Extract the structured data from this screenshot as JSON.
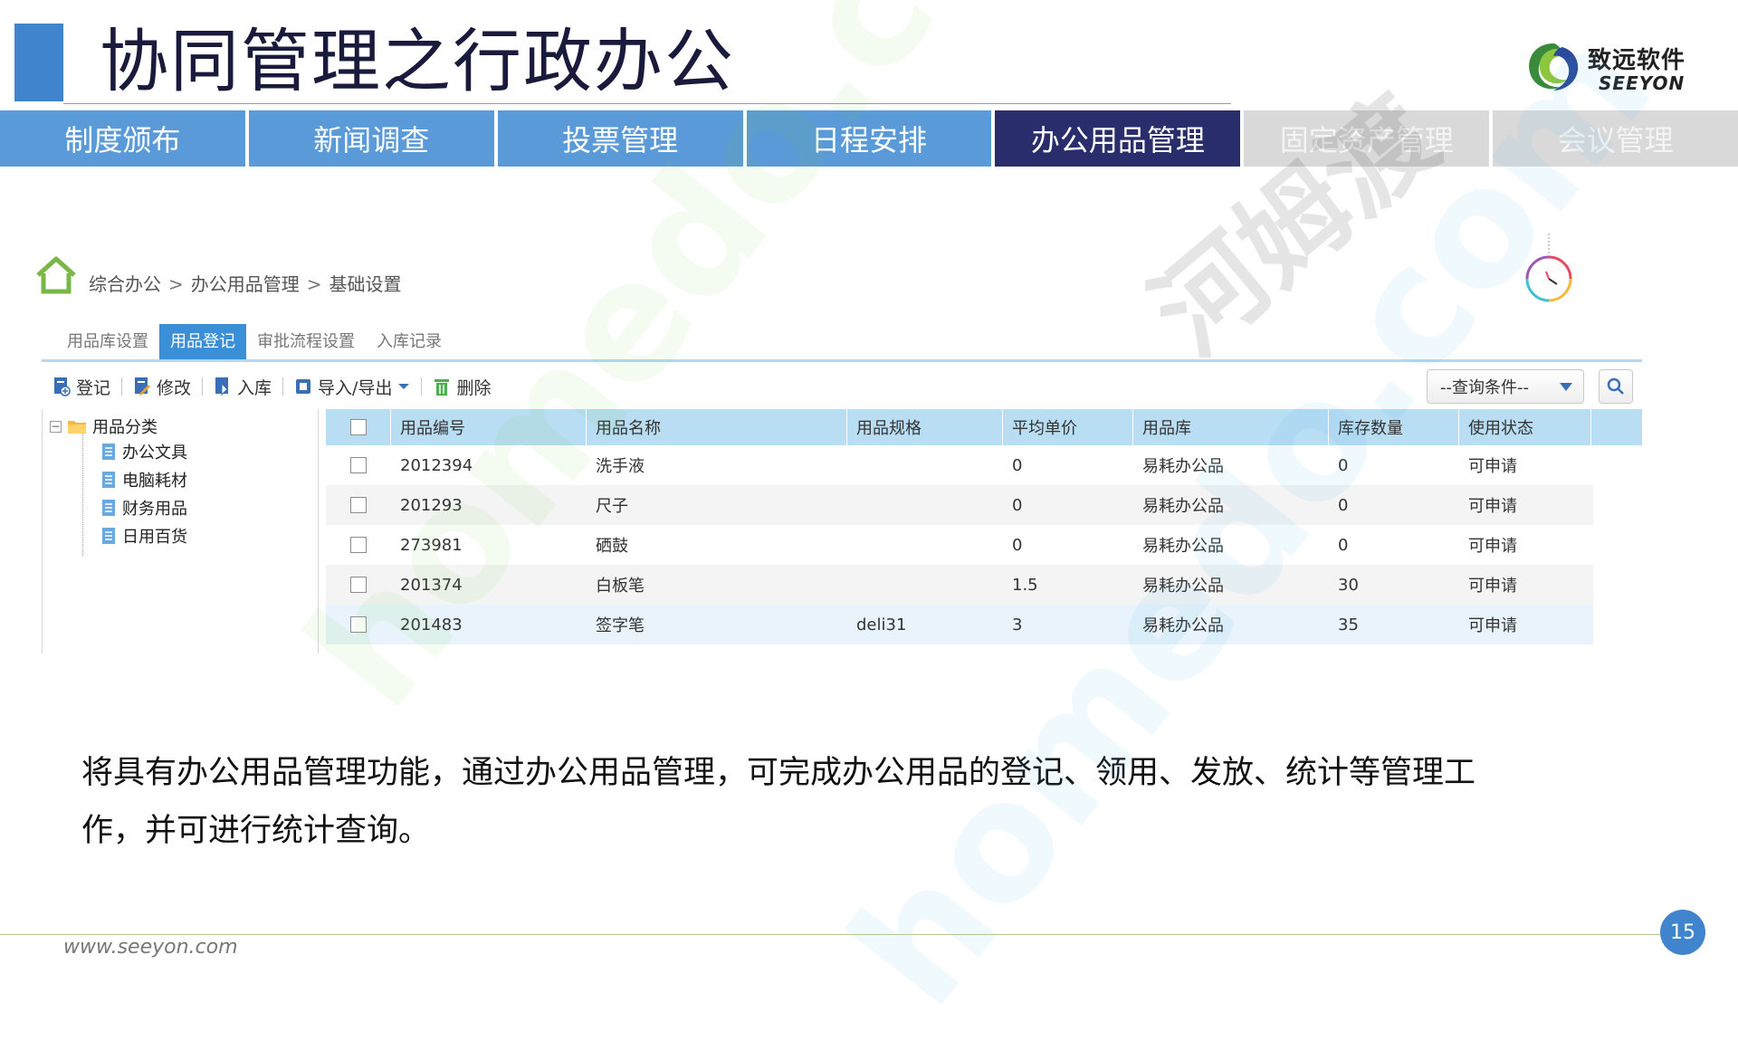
{
  "slide": {
    "title": "协同管理之行政办公",
    "page_number": "15",
    "footer_url": "www.seeyon.com",
    "description": "将具有办公用品管理功能，通过办公用品管理，可完成办公用品的登记、领用、发放、统计等管理工作，并可进行统计查询。"
  },
  "logo": {
    "cn": "致远软件",
    "en": "SEEYON"
  },
  "module_tabs": [
    {
      "label": "制度颁布",
      "state": "normal"
    },
    {
      "label": "新闻调查",
      "state": "normal"
    },
    {
      "label": "投票管理",
      "state": "normal"
    },
    {
      "label": "日程安排",
      "state": "normal"
    },
    {
      "label": "办公用品管理",
      "state": "active"
    },
    {
      "label": "固定资产管理",
      "state": "muted"
    },
    {
      "label": "会议管理",
      "state": "muted"
    }
  ],
  "breadcrumb": [
    "综合办公",
    "办公用品管理",
    "基础设置"
  ],
  "breadcrumb_separator": ">",
  "subtabs": [
    {
      "label": "用品库设置",
      "active": false
    },
    {
      "label": "用品登记",
      "active": true
    },
    {
      "label": "审批流程设置",
      "active": false
    },
    {
      "label": "入库记录",
      "active": false
    }
  ],
  "toolbar": {
    "register": "登记",
    "edit": "修改",
    "stock_in": "入库",
    "import_export": "导入/导出",
    "delete": "删除",
    "query_placeholder": "--查询条件--"
  },
  "tree": {
    "root": "用品分类",
    "children": [
      "办公文具",
      "电脑耗材",
      "财务用品",
      "日用百货"
    ]
  },
  "grid": {
    "columns": [
      "用品编号",
      "用品名称",
      "用品规格",
      "平均单价",
      "用品库",
      "库存数量",
      "使用状态"
    ],
    "rows": [
      [
        "2012394",
        "洗手液",
        "",
        "0",
        "易耗办公品",
        "0",
        "可申请"
      ],
      [
        "201293",
        "尺子",
        "",
        "0",
        "易耗办公品",
        "0",
        "可申请"
      ],
      [
        "273981",
        "硒鼓",
        "",
        "0",
        "易耗办公品",
        "0",
        "可申请"
      ],
      [
        "201374",
        "白板笔",
        "",
        "1.5",
        "易耗办公品",
        "30",
        "可申请"
      ],
      [
        "201483",
        "签字笔",
        "deli31",
        "3",
        "易耗办公品",
        "35",
        "可申请"
      ]
    ]
  },
  "watermarks": [
    "homedo.com",
    "homedo.com",
    "河姆渡"
  ],
  "colors": {
    "tab_blue": "#5b9ad8",
    "tab_active": "#2a2d6c",
    "tab_muted": "#d9d9d9",
    "accent_blue": "#3f84cc",
    "grid_header": "#b9ddf3"
  }
}
